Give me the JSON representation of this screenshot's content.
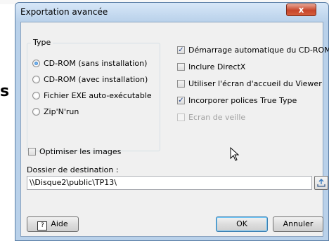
{
  "background": {
    "fragment_text": "s"
  },
  "dialog": {
    "title": "Exportation avancée",
    "close_label": "x"
  },
  "type_group": {
    "legend": "Type",
    "options": [
      {
        "label": "CD-ROM (sans installation)",
        "selected": true
      },
      {
        "label": "CD-ROM (avec installation)",
        "selected": false
      },
      {
        "label": "Fichier EXE auto-exécutable",
        "selected": false
      },
      {
        "label": "Zip'N'run",
        "selected": false
      }
    ]
  },
  "options": [
    {
      "label": "Démarrage automatique du CD-ROM",
      "checked": true,
      "enabled": true
    },
    {
      "label": "Inclure DirectX",
      "checked": false,
      "enabled": true
    },
    {
      "label": "Utiliser l'écran d'accueil du Viewer",
      "checked": false,
      "enabled": true
    },
    {
      "label": "Incorporer polices True Type",
      "checked": true,
      "enabled": true
    },
    {
      "label": "Ecran de veille",
      "checked": false,
      "enabled": false
    }
  ],
  "optimize": {
    "label": "Optimiser les images",
    "checked": false
  },
  "destination": {
    "label": "Dossier de destination :",
    "value": "\\\\Disque2\\public\\TP13\\"
  },
  "buttons": {
    "help": "Aide",
    "ok": "OK",
    "cancel": "Annuler"
  },
  "colors": {
    "frame": "#b9d1ea",
    "client": "#f0f0f0",
    "close": "#c7452a"
  }
}
